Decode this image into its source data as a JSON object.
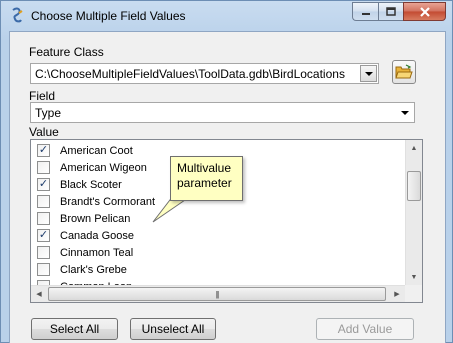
{
  "window": {
    "title": "Choose Multiple Field Values",
    "icon": "python-script-icon",
    "controls": [
      "minimize-icon",
      "maximize-icon",
      "close-icon"
    ]
  },
  "feature_class": {
    "label": "Feature Class",
    "value": "C:\\ChooseMultipleFieldValues\\ToolData.gdb\\BirdLocations",
    "browse_icon": "open-folder-icon"
  },
  "field": {
    "label": "Field",
    "value": "Type"
  },
  "value_list": {
    "label": "Value",
    "items": [
      {
        "label": "American Coot",
        "checked": true
      },
      {
        "label": "American Wigeon",
        "checked": false
      },
      {
        "label": "Black Scoter",
        "checked": true
      },
      {
        "label": "Brandt's Cormorant",
        "checked": false
      },
      {
        "label": "Brown Pelican",
        "checked": false
      },
      {
        "label": "Canada Goose",
        "checked": true
      },
      {
        "label": "Cinnamon Teal",
        "checked": false
      },
      {
        "label": "Clark's Grebe",
        "checked": false
      },
      {
        "label": "Common Loon",
        "checked": false
      }
    ]
  },
  "callout": {
    "line1": "Multivalue",
    "line2": "parameter"
  },
  "buttons": {
    "select_all": "Select All",
    "unselect_all": "Unselect All",
    "add_value": "Add Value"
  },
  "colors": {
    "title_bar": "#b9d1ea",
    "close_button": "#c34a31",
    "callout_bg": "#ffffc2"
  }
}
